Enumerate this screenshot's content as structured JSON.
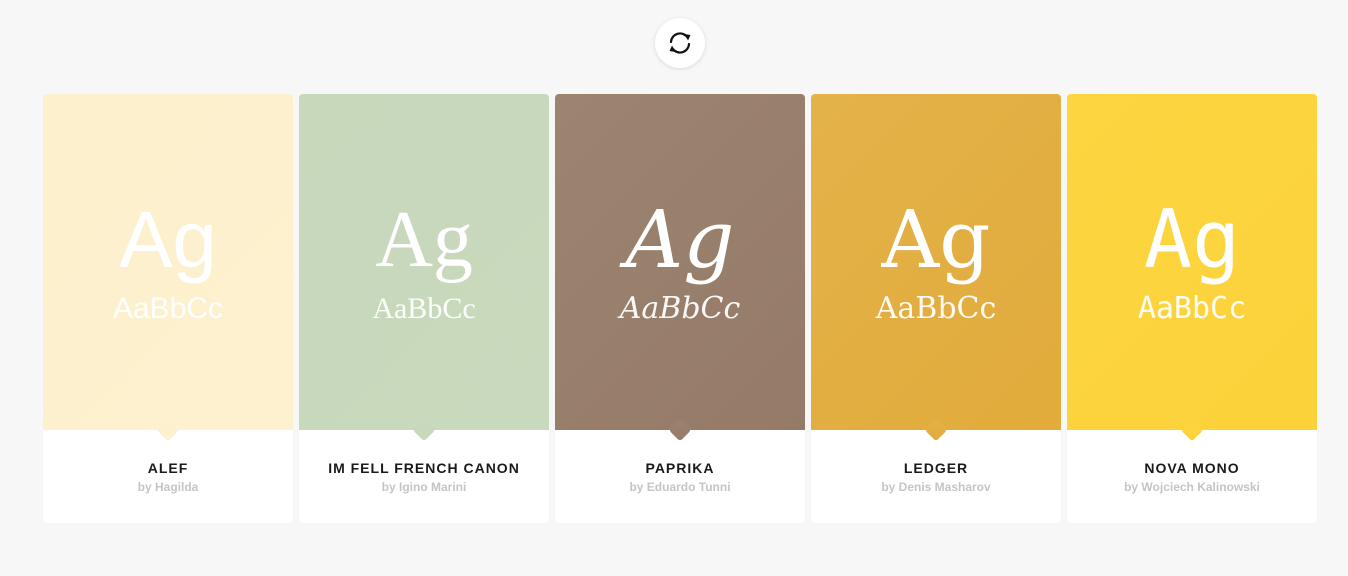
{
  "refresh": {
    "icon": "refresh-icon"
  },
  "cards": [
    {
      "name": "ALEF",
      "author": "by Hagilda",
      "sample_big": "Ag",
      "sample_small": "AaBbCc",
      "color_start": "#fdf0cc",
      "color_end": "#fdf1d0"
    },
    {
      "name": "IM FELL FRENCH CANON",
      "author": "by Igino Marini",
      "sample_big": "Ag",
      "sample_small": "AaBbCc",
      "color_start": "#c7d8bb",
      "color_end": "#c8d9bd"
    },
    {
      "name": "PAPRIKA",
      "author": "by Eduardo Tunni",
      "sample_big": "Ag",
      "sample_small": "AaBbCc",
      "color_start": "#9c8470",
      "color_end": "#957b67"
    },
    {
      "name": "LEDGER",
      "author": "by Denis Masharov",
      "sample_big": "Ag",
      "sample_small": "AaBbCc",
      "color_start": "#e3b24a",
      "color_end": "#e2ab3b"
    },
    {
      "name": "NOVA MONO",
      "author": "by Wojciech Kalinowski",
      "sample_big": "Ag",
      "sample_small": "AaBbCc",
      "color_start": "#fcd540",
      "color_end": "#fcd23a"
    }
  ]
}
